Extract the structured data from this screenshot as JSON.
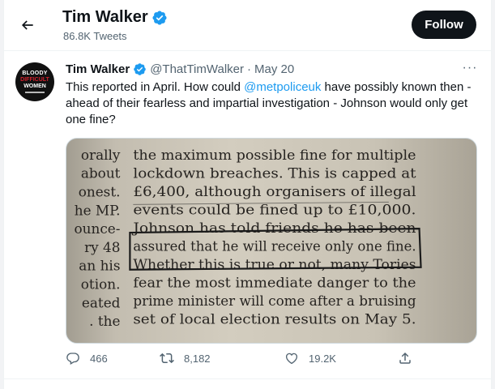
{
  "header": {
    "name": "Tim Walker",
    "tweet_count": "86.8K Tweets",
    "follow_label": "Follow"
  },
  "tweet": {
    "author": "Tim Walker",
    "handle": "@ThatTimWalker",
    "separator": "·",
    "date": "May 20",
    "more": "···",
    "text_before": "This reported in April. How could ",
    "mention": "@metpoliceuk",
    "text_after": " have possibly known then - ahead of their fearless and impartial investigation - Johnson would only get one fine?",
    "avatar": {
      "line1": "BLOODY",
      "line2": "DIFFICULT",
      "line3": "WOMEN"
    },
    "media": {
      "left_column": [
        "orally",
        "about",
        "onest.",
        "he MP.",
        "ounce-",
        "ry 48",
        "an his",
        "otion.",
        "eated",
        ". the"
      ],
      "right_column": [
        "the maximum possible fine for multiple",
        "lockdown breaches. This is capped at",
        "£6,400, although organisers of illegal",
        "events could be fined up to £10,000.",
        "Johnson has told friends he has been",
        "assured that he will receive only one fine.",
        "Whether this is true or not, many Tories",
        "fear the most immediate danger to the",
        "prime minister will come after a bruising",
        "set of local election results on May 5."
      ]
    },
    "actions": {
      "replies": "466",
      "retweets": "8,182",
      "likes": "19.2K"
    }
  },
  "icons": {
    "back": "arrow-left-icon",
    "verified": "verified-badge-icon",
    "reply": "reply-icon",
    "retweet": "retweet-icon",
    "like": "heart-icon",
    "share": "share-icon"
  },
  "colors": {
    "accent": "#1d9bf0",
    "follow_bg": "#0f1419",
    "muted": "#536471"
  }
}
